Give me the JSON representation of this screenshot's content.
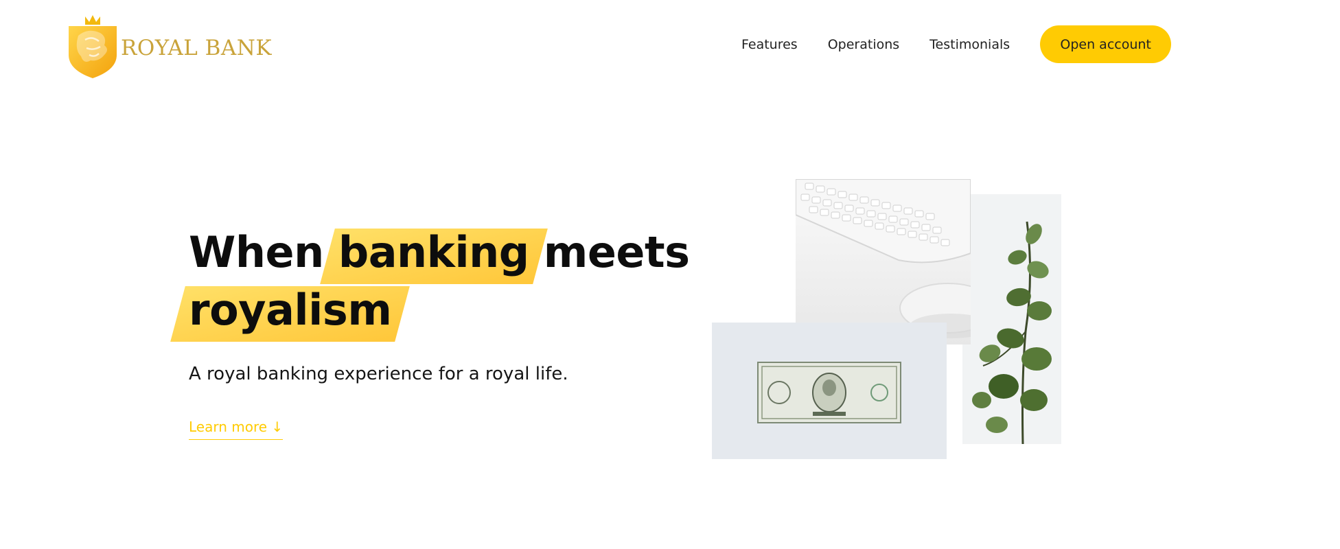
{
  "brand": {
    "name": "ROYAL BANK",
    "logo_icon": "lion-crest-icon",
    "color": "#c9a33a"
  },
  "nav": {
    "items": [
      "Features",
      "Operations",
      "Testimonials"
    ],
    "cta": "Open account"
  },
  "hero": {
    "title": {
      "part1": "When",
      "highlight1": "banking",
      "part2": "meets",
      "highlight2": "royalism"
    },
    "subtitle": "A royal banking experience for a royal life.",
    "learn_more": "Learn more ↓"
  },
  "images": {
    "keyboard": "keyboard-and-mouse-image",
    "dollar": "dollar-bill-image",
    "plant": "eucalyptus-plant-image"
  },
  "colors": {
    "accent": "#ffcb03",
    "highlight": "#ffd54a",
    "text": "#0d0d0d"
  }
}
